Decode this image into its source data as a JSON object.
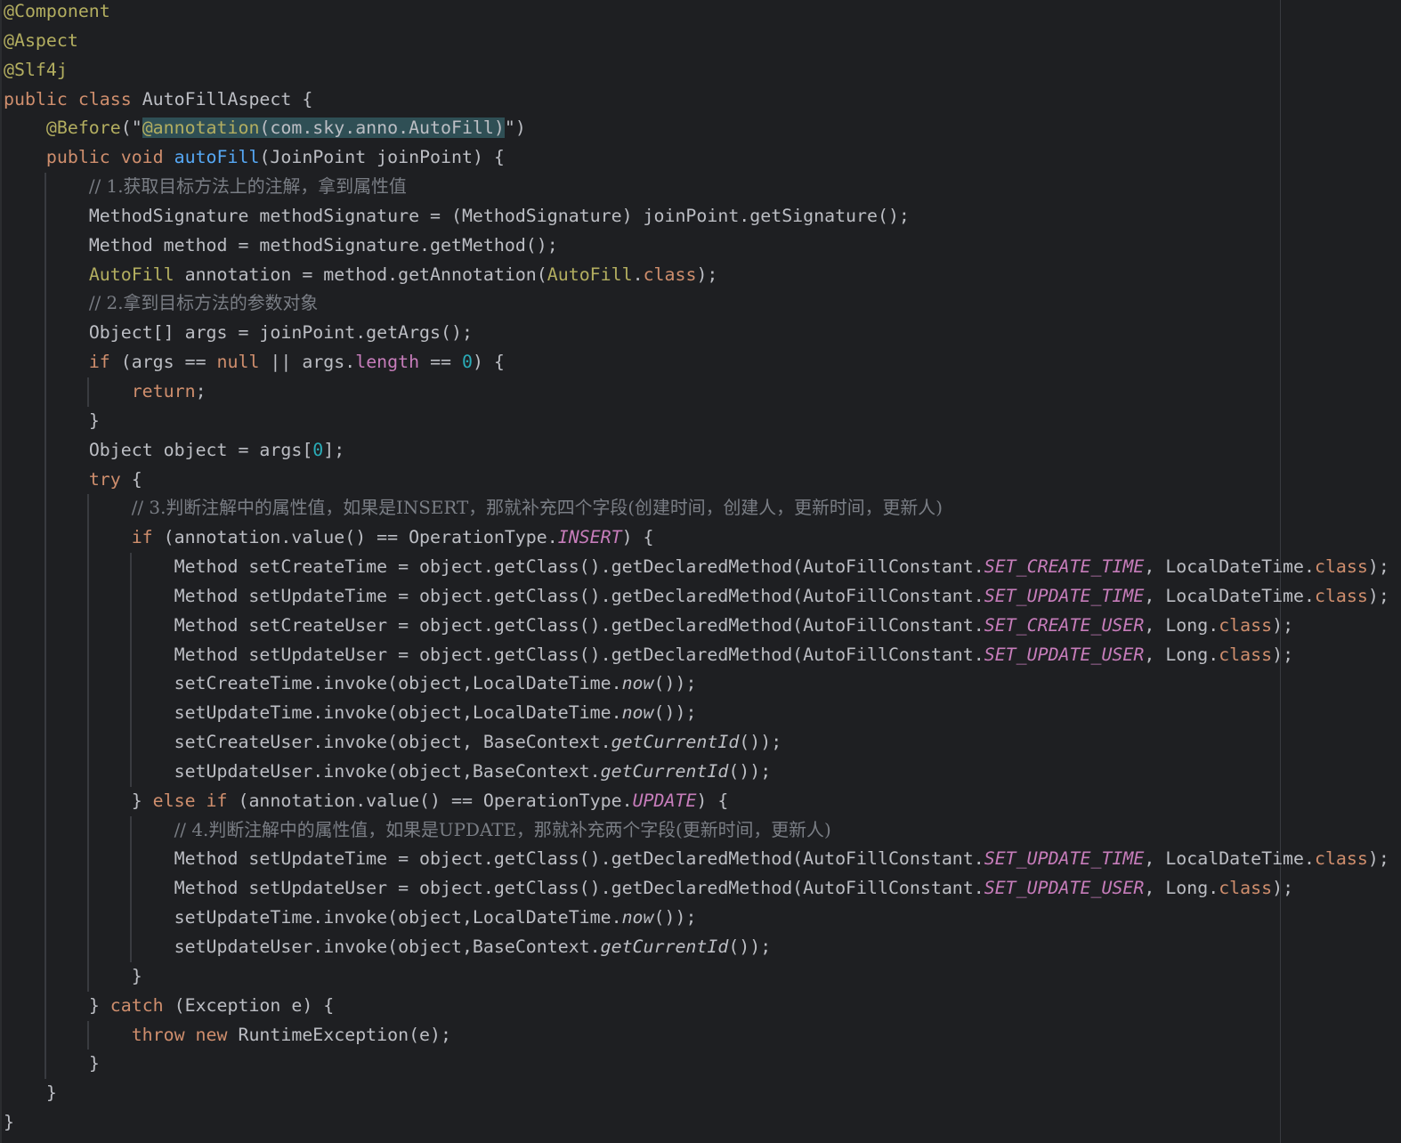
{
  "editor": {
    "theme_colors": {
      "background": "#1e1f22",
      "plain": "#bcbec4",
      "keyword": "#cf8e6d",
      "annotation": "#b3ae60",
      "comment": "#7a7e85",
      "method_declaration": "#56a8f5",
      "number": "#2aacb8",
      "field": "#c77dbb",
      "highlight": "#2f4f55"
    },
    "lines": [
      {
        "indent": 0,
        "guides": [],
        "tokens": [
          {
            "t": "@Component",
            "c": "ann"
          }
        ]
      },
      {
        "indent": 0,
        "guides": [],
        "tokens": [
          {
            "t": "@Aspect",
            "c": "ann"
          }
        ]
      },
      {
        "indent": 0,
        "guides": [],
        "tokens": [
          {
            "t": "@Slf4j",
            "c": "ann"
          }
        ]
      },
      {
        "indent": 0,
        "guides": [],
        "tokens": [
          {
            "t": "public ",
            "c": "kw"
          },
          {
            "t": "class ",
            "c": "kw"
          },
          {
            "t": "AutoFillAspect {",
            "c": "plain"
          }
        ]
      },
      {
        "indent": 4,
        "guides": [],
        "tokens": [
          {
            "t": "@Before",
            "c": "ann"
          },
          {
            "t": "(\"",
            "c": "plain"
          },
          {
            "t": "@annotation",
            "c": "ann-hl"
          },
          {
            "t": "(com.sky.anno.AutoFill)",
            "c": "str-hl"
          },
          {
            "t": "\")",
            "c": "plain"
          }
        ]
      },
      {
        "indent": 4,
        "guides": [],
        "tokens": [
          {
            "t": "public ",
            "c": "kw"
          },
          {
            "t": "void ",
            "c": "kw"
          },
          {
            "t": "autoFill",
            "c": "method"
          },
          {
            "t": "(JoinPoint joinPoint) {",
            "c": "plain"
          }
        ]
      },
      {
        "indent": 8,
        "guides": [
          4
        ],
        "tokens": [
          {
            "t": "// 1.获取目标方法上的注解，拿到属性值",
            "c": "comment"
          }
        ]
      },
      {
        "indent": 8,
        "guides": [
          4
        ],
        "tokens": [
          {
            "t": "MethodSignature methodSignature = (MethodSignature) joinPoint.getSignature();",
            "c": "plain"
          }
        ]
      },
      {
        "indent": 8,
        "guides": [
          4
        ],
        "tokens": [
          {
            "t": "Method method = methodSignature.getMethod();",
            "c": "plain"
          }
        ]
      },
      {
        "indent": 8,
        "guides": [
          4
        ],
        "tokens": [
          {
            "t": "AutoFill",
            "c": "ann"
          },
          {
            "t": " annotation = method.getAnnotation(",
            "c": "plain"
          },
          {
            "t": "AutoFill",
            "c": "ann"
          },
          {
            "t": ".",
            "c": "plain"
          },
          {
            "t": "class",
            "c": "kw"
          },
          {
            "t": ");",
            "c": "plain"
          }
        ]
      },
      {
        "indent": 8,
        "guides": [
          4
        ],
        "tokens": [
          {
            "t": "// 2.拿到目标方法的参数对象",
            "c": "comment"
          }
        ]
      },
      {
        "indent": 8,
        "guides": [
          4
        ],
        "tokens": [
          {
            "t": "Object[] args = joinPoint.getArgs();",
            "c": "plain"
          }
        ]
      },
      {
        "indent": 8,
        "guides": [
          4
        ],
        "tokens": [
          {
            "t": "if ",
            "c": "kw"
          },
          {
            "t": "(args == ",
            "c": "plain"
          },
          {
            "t": "null ",
            "c": "kw"
          },
          {
            "t": "|| args.",
            "c": "plain"
          },
          {
            "t": "length",
            "c": "field"
          },
          {
            "t": " == ",
            "c": "plain"
          },
          {
            "t": "0",
            "c": "num"
          },
          {
            "t": ") {",
            "c": "plain"
          }
        ]
      },
      {
        "indent": 12,
        "guides": [
          4,
          8
        ],
        "tokens": [
          {
            "t": "return",
            "c": "kw"
          },
          {
            "t": ";",
            "c": "plain"
          }
        ]
      },
      {
        "indent": 8,
        "guides": [
          4
        ],
        "tokens": [
          {
            "t": "}",
            "c": "plain"
          }
        ]
      },
      {
        "indent": 8,
        "guides": [
          4
        ],
        "tokens": [
          {
            "t": "Object object = args[",
            "c": "plain"
          },
          {
            "t": "0",
            "c": "num"
          },
          {
            "t": "];",
            "c": "plain"
          }
        ]
      },
      {
        "indent": 8,
        "guides": [
          4
        ],
        "tokens": [
          {
            "t": "try ",
            "c": "kw"
          },
          {
            "t": "{",
            "c": "plain"
          }
        ]
      },
      {
        "indent": 12,
        "guides": [
          4,
          8
        ],
        "tokens": [
          {
            "t": "// 3.判断注解中的属性值，如果是INSERT，那就补充四个字段(创建时间，创建人，更新时间，更新人)",
            "c": "comment"
          }
        ]
      },
      {
        "indent": 12,
        "guides": [
          4,
          8
        ],
        "tokens": [
          {
            "t": "if ",
            "c": "kw"
          },
          {
            "t": "(annotation.value() == OperationType.",
            "c": "plain"
          },
          {
            "t": "INSERT",
            "c": "static-field"
          },
          {
            "t": ") {",
            "c": "plain"
          }
        ]
      },
      {
        "indent": 16,
        "guides": [
          4,
          8,
          12
        ],
        "tokens": [
          {
            "t": "Method setCreateTime = object.getClass().getDeclaredMethod(AutoFillConstant.",
            "c": "plain"
          },
          {
            "t": "SET_CREATE_TIME",
            "c": "static-field"
          },
          {
            "t": ", LocalDateTime.",
            "c": "plain"
          },
          {
            "t": "class",
            "c": "kw"
          },
          {
            "t": ");",
            "c": "plain"
          }
        ]
      },
      {
        "indent": 16,
        "guides": [
          4,
          8,
          12
        ],
        "tokens": [
          {
            "t": "Method setUpdateTime = object.getClass().getDeclaredMethod(AutoFillConstant.",
            "c": "plain"
          },
          {
            "t": "SET_UPDATE_TIME",
            "c": "static-field"
          },
          {
            "t": ", LocalDateTime.",
            "c": "plain"
          },
          {
            "t": "class",
            "c": "kw"
          },
          {
            "t": ");",
            "c": "plain"
          }
        ]
      },
      {
        "indent": 16,
        "guides": [
          4,
          8,
          12
        ],
        "tokens": [
          {
            "t": "Method setCreateUser = object.getClass().getDeclaredMethod(AutoFillConstant.",
            "c": "plain"
          },
          {
            "t": "SET_CREATE_USER",
            "c": "static-field"
          },
          {
            "t": ", Long.",
            "c": "plain"
          },
          {
            "t": "class",
            "c": "kw"
          },
          {
            "t": ");",
            "c": "plain"
          }
        ]
      },
      {
        "indent": 16,
        "guides": [
          4,
          8,
          12
        ],
        "tokens": [
          {
            "t": "Method setUpdateUser = object.getClass().getDeclaredMethod(AutoFillConstant.",
            "c": "plain"
          },
          {
            "t": "SET_UPDATE_USER",
            "c": "static-field"
          },
          {
            "t": ", Long.",
            "c": "plain"
          },
          {
            "t": "class",
            "c": "kw"
          },
          {
            "t": ");",
            "c": "plain"
          }
        ]
      },
      {
        "indent": 16,
        "guides": [
          4,
          8,
          12
        ],
        "tokens": [
          {
            "t": "setCreateTime.invoke(object,LocalDateTime.",
            "c": "plain"
          },
          {
            "t": "now",
            "c": "static-method"
          },
          {
            "t": "());",
            "c": "plain"
          }
        ]
      },
      {
        "indent": 16,
        "guides": [
          4,
          8,
          12
        ],
        "tokens": [
          {
            "t": "setUpdateTime.invoke(object,LocalDateTime.",
            "c": "plain"
          },
          {
            "t": "now",
            "c": "static-method"
          },
          {
            "t": "());",
            "c": "plain"
          }
        ]
      },
      {
        "indent": 16,
        "guides": [
          4,
          8,
          12
        ],
        "tokens": [
          {
            "t": "setCreateUser.invoke(object, BaseContext.",
            "c": "plain"
          },
          {
            "t": "getCurrentId",
            "c": "static-method"
          },
          {
            "t": "());",
            "c": "plain"
          }
        ]
      },
      {
        "indent": 16,
        "guides": [
          4,
          8,
          12
        ],
        "tokens": [
          {
            "t": "setUpdateUser.invoke(object,BaseContext.",
            "c": "plain"
          },
          {
            "t": "getCurrentId",
            "c": "static-method"
          },
          {
            "t": "());",
            "c": "plain"
          }
        ]
      },
      {
        "indent": 12,
        "guides": [
          4,
          8
        ],
        "tokens": [
          {
            "t": "} ",
            "c": "plain"
          },
          {
            "t": "else if ",
            "c": "kw"
          },
          {
            "t": "(annotation.value() == OperationType.",
            "c": "plain"
          },
          {
            "t": "UPDATE",
            "c": "static-field"
          },
          {
            "t": ") {",
            "c": "plain"
          }
        ]
      },
      {
        "indent": 16,
        "guides": [
          4,
          8,
          12
        ],
        "tokens": [
          {
            "t": "// 4.判断注解中的属性值，如果是UPDATE，那就补充两个字段(更新时间，更新人)",
            "c": "comment"
          }
        ]
      },
      {
        "indent": 16,
        "guides": [
          4,
          8,
          12
        ],
        "tokens": [
          {
            "t": "Method setUpdateTime = object.getClass().getDeclaredMethod(AutoFillConstant.",
            "c": "plain"
          },
          {
            "t": "SET_UPDATE_TIME",
            "c": "static-field"
          },
          {
            "t": ", LocalDateTime.",
            "c": "plain"
          },
          {
            "t": "class",
            "c": "kw"
          },
          {
            "t": ");",
            "c": "plain"
          }
        ]
      },
      {
        "indent": 16,
        "guides": [
          4,
          8,
          12
        ],
        "tokens": [
          {
            "t": "Method setUpdateUser = object.getClass().getDeclaredMethod(AutoFillConstant.",
            "c": "plain"
          },
          {
            "t": "SET_UPDATE_USER",
            "c": "static-field"
          },
          {
            "t": ", Long.",
            "c": "plain"
          },
          {
            "t": "class",
            "c": "kw"
          },
          {
            "t": ");",
            "c": "plain"
          }
        ]
      },
      {
        "indent": 16,
        "guides": [
          4,
          8,
          12
        ],
        "tokens": [
          {
            "t": "setUpdateTime.invoke(object,LocalDateTime.",
            "c": "plain"
          },
          {
            "t": "now",
            "c": "static-method"
          },
          {
            "t": "());",
            "c": "plain"
          }
        ]
      },
      {
        "indent": 16,
        "guides": [
          4,
          8,
          12
        ],
        "tokens": [
          {
            "t": "setUpdateUser.invoke(object,BaseContext.",
            "c": "plain"
          },
          {
            "t": "getCurrentId",
            "c": "static-method"
          },
          {
            "t": "());",
            "c": "plain"
          }
        ]
      },
      {
        "indent": 12,
        "guides": [
          4,
          8
        ],
        "tokens": [
          {
            "t": "}",
            "c": "plain"
          }
        ]
      },
      {
        "indent": 8,
        "guides": [
          4
        ],
        "tokens": [
          {
            "t": "} ",
            "c": "plain"
          },
          {
            "t": "catch ",
            "c": "kw"
          },
          {
            "t": "(Exception e) {",
            "c": "plain"
          }
        ]
      },
      {
        "indent": 12,
        "guides": [
          4,
          8
        ],
        "tokens": [
          {
            "t": "throw new ",
            "c": "kw"
          },
          {
            "t": "RuntimeException(e);",
            "c": "plain"
          }
        ]
      },
      {
        "indent": 8,
        "guides": [
          4
        ],
        "tokens": [
          {
            "t": "}",
            "c": "plain"
          }
        ]
      },
      {
        "indent": 4,
        "guides": [],
        "tokens": [
          {
            "t": "}",
            "c": "plain"
          }
        ]
      },
      {
        "indent": 0,
        "guides": [],
        "tokens": [
          {
            "t": "}",
            "c": "plain"
          }
        ]
      }
    ]
  }
}
